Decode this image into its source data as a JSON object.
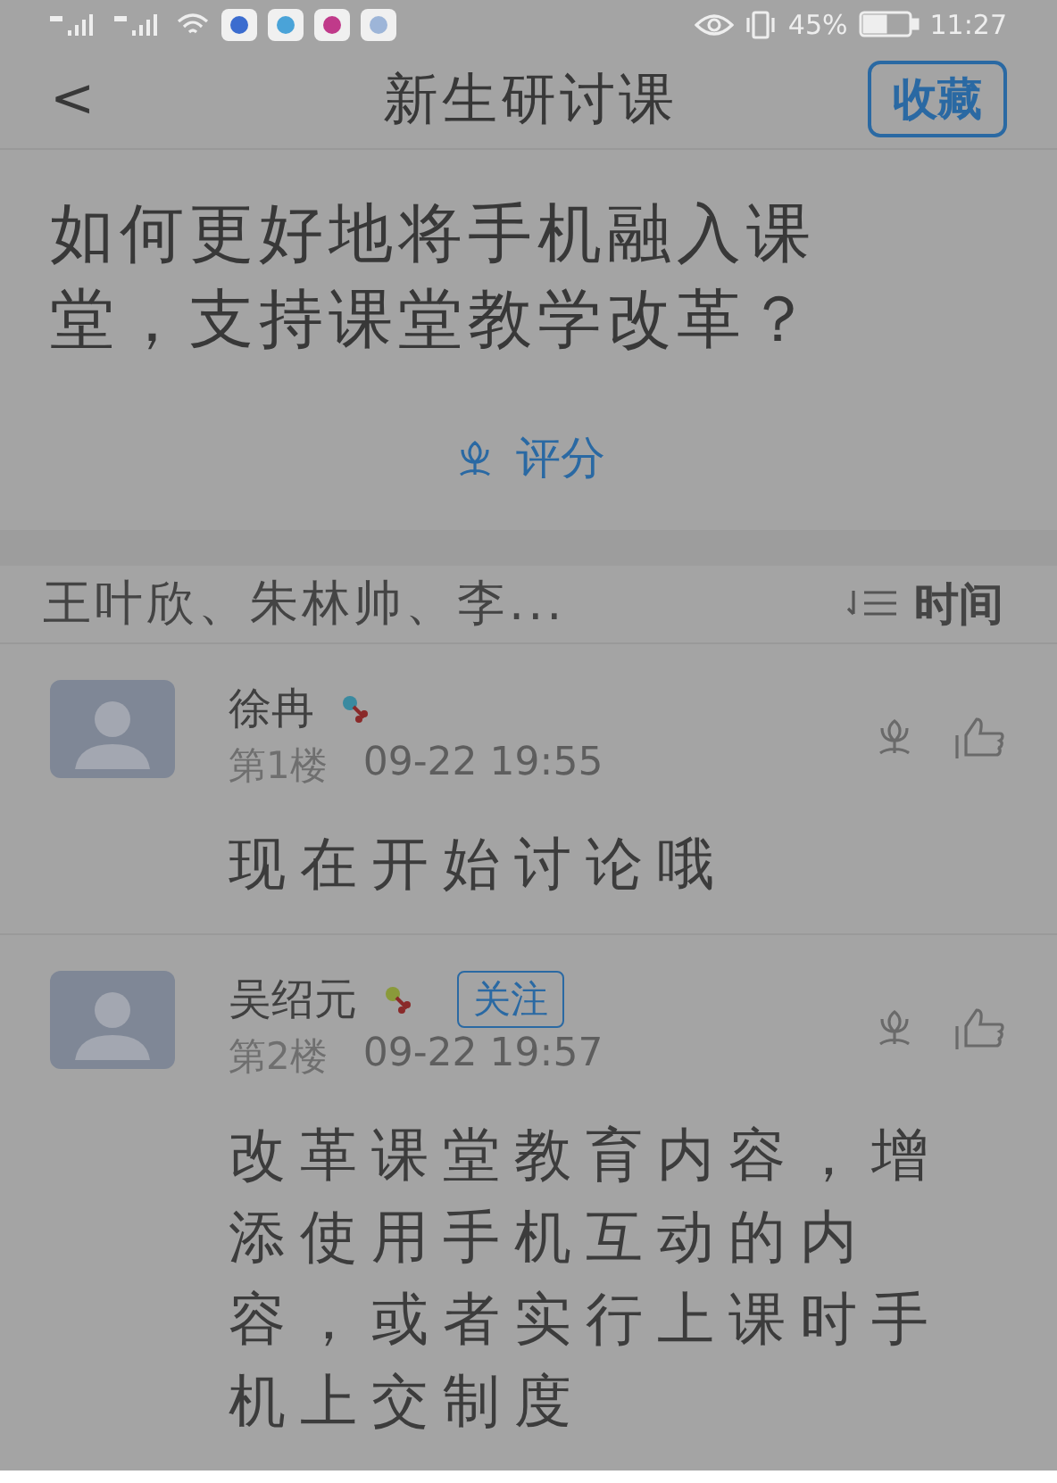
{
  "status_bar": {
    "battery": "45%",
    "time": "11:27"
  },
  "nav": {
    "back": "<",
    "title": "新生研讨课",
    "action": "收藏"
  },
  "question": "如何更好地将手机融入课堂，支持课堂教学改革？",
  "rate": {
    "label": "评分"
  },
  "filter": {
    "participants": "王叶欣、朱林帅、李...",
    "sort": "时间"
  },
  "posts": [
    {
      "name": "徐冉",
      "floor": "第1楼",
      "time": "09-22 19:55",
      "body": "现在开始讨论哦"
    },
    {
      "name": "吴绍元",
      "follow": "关注",
      "floor": "第2楼",
      "time": "09-22 19:57",
      "body": "改革课堂教育内容，增添使用手机互动的内容，或者实行上课时手机上交制度"
    }
  ]
}
